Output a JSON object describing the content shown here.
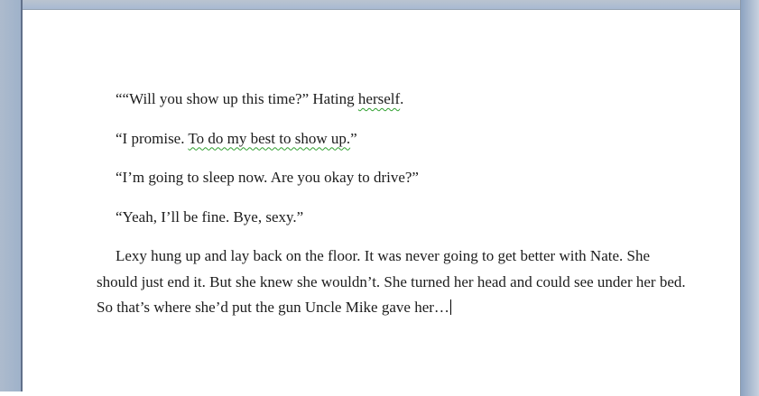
{
  "colors": {
    "workspace_background": "#a8bad2",
    "page_background": "#ffffff",
    "grammar_squiggle": "#2e9e2e",
    "text_color": "#1c1c1c"
  },
  "document": {
    "paragraphs": {
      "p1": {
        "pre": "““Will you show up this time?” Hating ",
        "grammar": "herself",
        "post": "."
      },
      "p2": {
        "pre": "“I promise. ",
        "grammar": "To do my best to show up.",
        "post": "”"
      },
      "p3": {
        "text": "“I’m going to sleep now. Are you okay to drive?”"
      },
      "p4": {
        "text": "“Yeah, I’ll be fine. Bye, sexy.”"
      },
      "p5": {
        "line1": "Lexy hung up and lay back on the floor. It was never going to get better with Nate. She",
        "line2": "should just end it. But she knew she wouldn’t. She turned her head and could see under her bed.",
        "line3": "So that’s where she’d put the gun Uncle Mike gave her…"
      }
    }
  }
}
